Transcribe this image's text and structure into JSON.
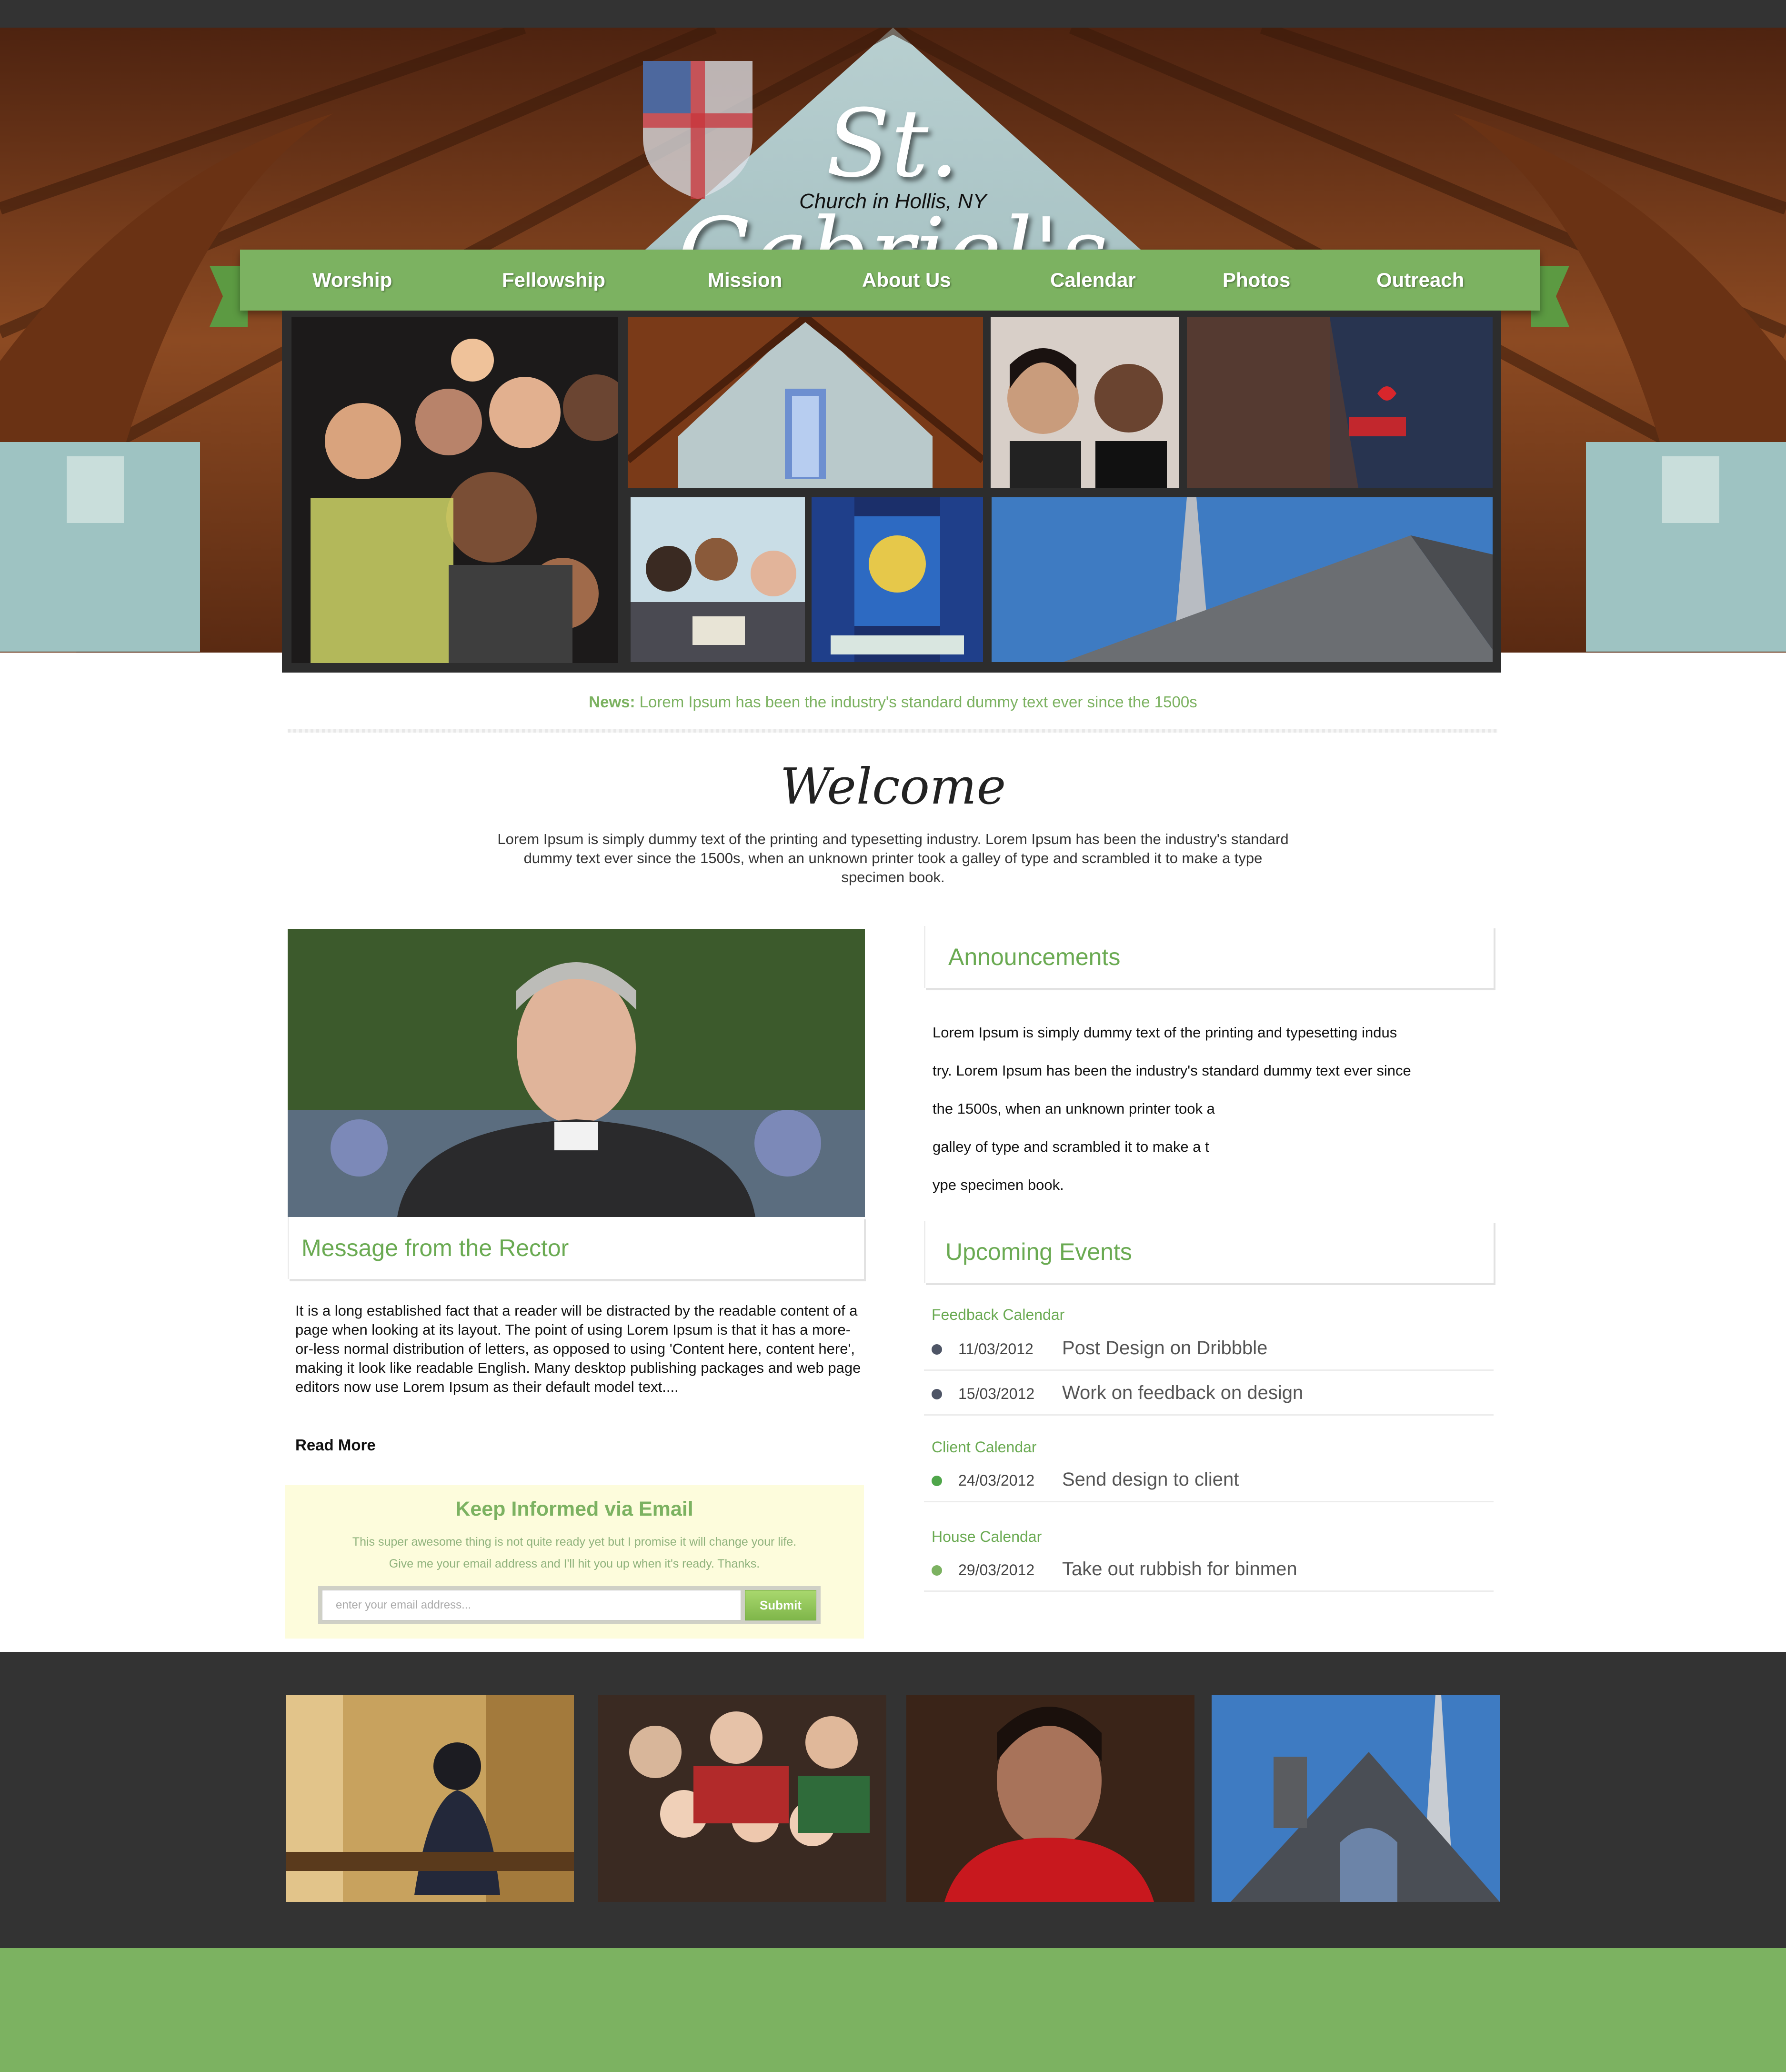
{
  "site": {
    "title": "St. Gabriel's",
    "subtitle": "Church in Hollis, NY"
  },
  "nav": {
    "items": [
      {
        "label": "Worship"
      },
      {
        "label": "Fellowship"
      },
      {
        "label": "Mission"
      },
      {
        "label": "About Us"
      },
      {
        "label": "Calendar"
      },
      {
        "label": "Photos"
      },
      {
        "label": "Outreach"
      }
    ]
  },
  "news": {
    "label": "News:",
    "text": "Lorem Ipsum has been the industry's standard dummy text ever since the 1500s"
  },
  "welcome": {
    "title": "Welcome",
    "text": "Lorem Ipsum is simply dummy text of the printing and typesetting industry. Lorem Ipsum has been the industry's standard dummy text ever since the 1500s, when an unknown printer took a galley of type and scrambled it to make a type specimen book."
  },
  "rector": {
    "heading": "Message from the Rector",
    "text": "It is a long established fact that a reader will be distracted by the readable content of a page when looking at its layout. The point of using Lorem Ipsum is that it has a more-or-less normal distribution of letters, as opposed to using 'Content here, content here', making it look like readable English. Many desktop publishing packages and web page editors now use Lorem Ipsum as their default model text....",
    "read_more": "Read More"
  },
  "email_signup": {
    "title": "Keep Informed via Email",
    "line1": "This super awesome thing is not quite ready yet but I promise it will change your life.",
    "line2": "Give me your email address and I'll hit you up when it's ready. Thanks.",
    "placeholder": "enter your email address...",
    "submit_label": "Submit"
  },
  "announcements": {
    "heading": "Announcements",
    "lines": [
      "Lorem Ipsum is simply dummy text of the printing and typesetting indus",
      "try. Lorem Ipsum has been the industry's standard dummy text ever since",
      "the 1500s, when an unknown printer took a",
      "galley of type and scrambled it to make a t",
      "ype specimen book."
    ]
  },
  "events": {
    "heading": "Upcoming Events",
    "groups": [
      {
        "name": "Feedback Calendar",
        "items": [
          {
            "date": "11/03/2012",
            "title": "Post Design on Dribbble"
          },
          {
            "date": "15/03/2012",
            "title": "Work on feedback on design"
          }
        ]
      },
      {
        "name": "Client Calendar",
        "items": [
          {
            "date": "24/03/2012",
            "title": "Send design to client"
          }
        ]
      },
      {
        "name": "House Calendar",
        "items": [
          {
            "date": "29/03/2012",
            "title": "Take out rubbish for binmen"
          }
        ]
      }
    ]
  },
  "colors": {
    "brand_green": "#7cb261",
    "heading_green": "#6aaa52",
    "dark": "#333333",
    "dot_dark": "#4e5566",
    "dot_green": "#4fa64a",
    "dot_light_green": "#7cb261"
  },
  "icons": {
    "logo_shield": "episcopal-shield-icon",
    "event_bullet": "dot-icon"
  }
}
